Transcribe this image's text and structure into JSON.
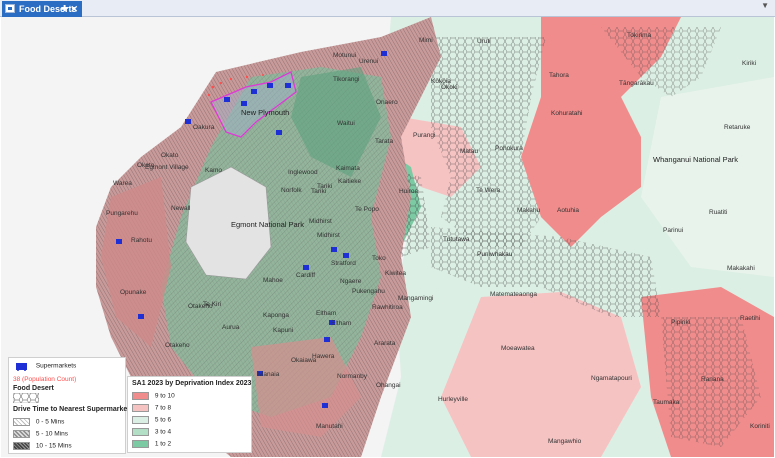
{
  "tab": {
    "title": "Food Deserts",
    "pin_icon": "pin-icon",
    "close_icon": "close-icon"
  },
  "map": {
    "places": [
      "Mimi",
      "Uruti",
      "Tokirima",
      "Kiriki",
      "Motunui",
      "Urenui",
      "Tahora",
      "Tāngarākau",
      "Kōkōia",
      "Ōkoki",
      "Tikorangi",
      "Onaero",
      "Kohuratahi",
      "Retaruke",
      "New Plymouth",
      "Purangi",
      "Tarata",
      "Oakura",
      "Waitui",
      "Matau",
      "Pohokura",
      "Whanganui National Park",
      "Okato",
      "Egmont Village",
      "Kamo",
      "Inglewood",
      "Kaimata",
      "Kaitieke",
      "Okato",
      "Warea",
      "Norfolk",
      "Tariki",
      "Tariki",
      "Te Wera",
      "Huiroa",
      "Aotuhia",
      "Newall",
      "Pungarehu",
      "Ruatiti",
      "Egmont National Park",
      "Midhirst",
      "Te Popo",
      "Makahu",
      "Parinui",
      "Rahotu",
      "Midhirst",
      "Stratford",
      "Toko",
      "Tututawa",
      "Puniwhakau",
      "Makakahi",
      "Opunake",
      "Cardiff",
      "Kiwitea",
      "Mahoe",
      "Ngaere",
      "Pukengahu",
      "Matemateaonga",
      "Otakeho",
      "Te Kiri",
      "Kaponga",
      "Eltham",
      "Rawhitiroa",
      "Mangamingi",
      "Raetihi",
      "Aurua",
      "Kapuni",
      "Eltham",
      "Pipiriki",
      "Ararata",
      "Moeawatea",
      "Otakeho",
      "Hawera",
      "Normanby",
      "Ohangai",
      "Ngamatapouri",
      "Ranana",
      "Manaia",
      "Okaiawa",
      "Hurleyville",
      "Taumaka",
      "Manutahi",
      "Mangawhio",
      "Koriniti"
    ]
  },
  "legend_left": {
    "supermarkets_label": "Supermarkets",
    "population_label": "38 (Population Count)",
    "food_desert_title": "Food Desert",
    "drive_title": "Drive Time to Nearest Supermarket",
    "drive_items": [
      "0 - 5 Mins",
      "5 - 10 Mins",
      "10 - 15 Mins"
    ]
  },
  "legend_right": {
    "title": "SA1 2023 by Deprivation Index 2023",
    "items": [
      {
        "label": "9  to  10",
        "color": "#f08c8c"
      },
      {
        "label": "7  to  8",
        "color": "#f6c3c3"
      },
      {
        "label": "5  to  6",
        "color": "#dcefe4"
      },
      {
        "label": "3  to  4",
        "color": "#b3dfc6"
      },
      {
        "label": "1  to  2",
        "color": "#7ccaa3"
      }
    ]
  },
  "colors": {
    "tab_bg": "#2c6dc4",
    "supermarket": "#1f2fd6",
    "population": "#ff4d4d",
    "urban_outline": "#e038d8"
  }
}
